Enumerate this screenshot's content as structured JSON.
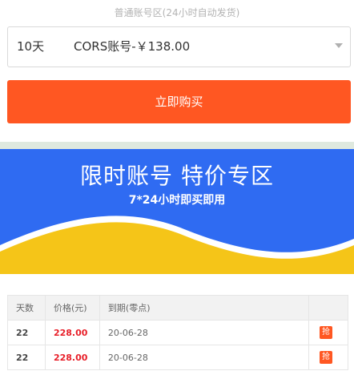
{
  "header": {
    "title": "普通账号区(24小时自动发货)"
  },
  "product_select": {
    "days": "10天",
    "product": "CORS账号-￥138.00"
  },
  "buy_button": {
    "label": "立即购买"
  },
  "banner": {
    "title": "限时账号 特价专区",
    "subtitle": "7*24小时即买即用",
    "colors": {
      "background": "#2f6bf2",
      "wave": "#f5c518"
    }
  },
  "table": {
    "headers": [
      "天数",
      "价格(元)",
      "到期(零点)",
      ""
    ],
    "rows": [
      {
        "days": "22",
        "price": "228.00",
        "expire": "20-06-28",
        "action": "抢"
      },
      {
        "days": "22",
        "price": "228.00",
        "expire": "20-06-28",
        "action": "抢"
      }
    ]
  },
  "colors": {
    "accent": "#ff5722",
    "price": "#e8202a"
  }
}
